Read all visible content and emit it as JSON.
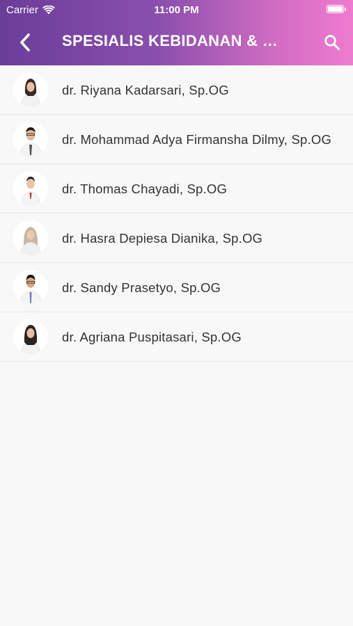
{
  "status_bar": {
    "carrier": "Carrier",
    "time": "11:00 PM"
  },
  "nav": {
    "title": "SPESIALIS KEBIDANAN & KANDUNGAN",
    "back_icon": "chevron-left-icon",
    "search_icon": "search-icon"
  },
  "colors": {
    "gradient_start": "#6a3d99",
    "gradient_end": "#ee7bd0",
    "list_bg": "#f8f8f8",
    "text": "#333333"
  },
  "doctors": [
    {
      "name": "dr. Riyana Kadarsari, Sp.OG"
    },
    {
      "name": "dr. Mohammad Adya Firmansha Dilmy, Sp.OG"
    },
    {
      "name": "dr. Thomas Chayadi, Sp.OG"
    },
    {
      "name": "dr. Hasra Depiesa Dianika, Sp.OG"
    },
    {
      "name": "dr. Sandy Prasetyo, Sp.OG"
    },
    {
      "name": "dr. Agriana Puspitasari, Sp.OG"
    }
  ]
}
